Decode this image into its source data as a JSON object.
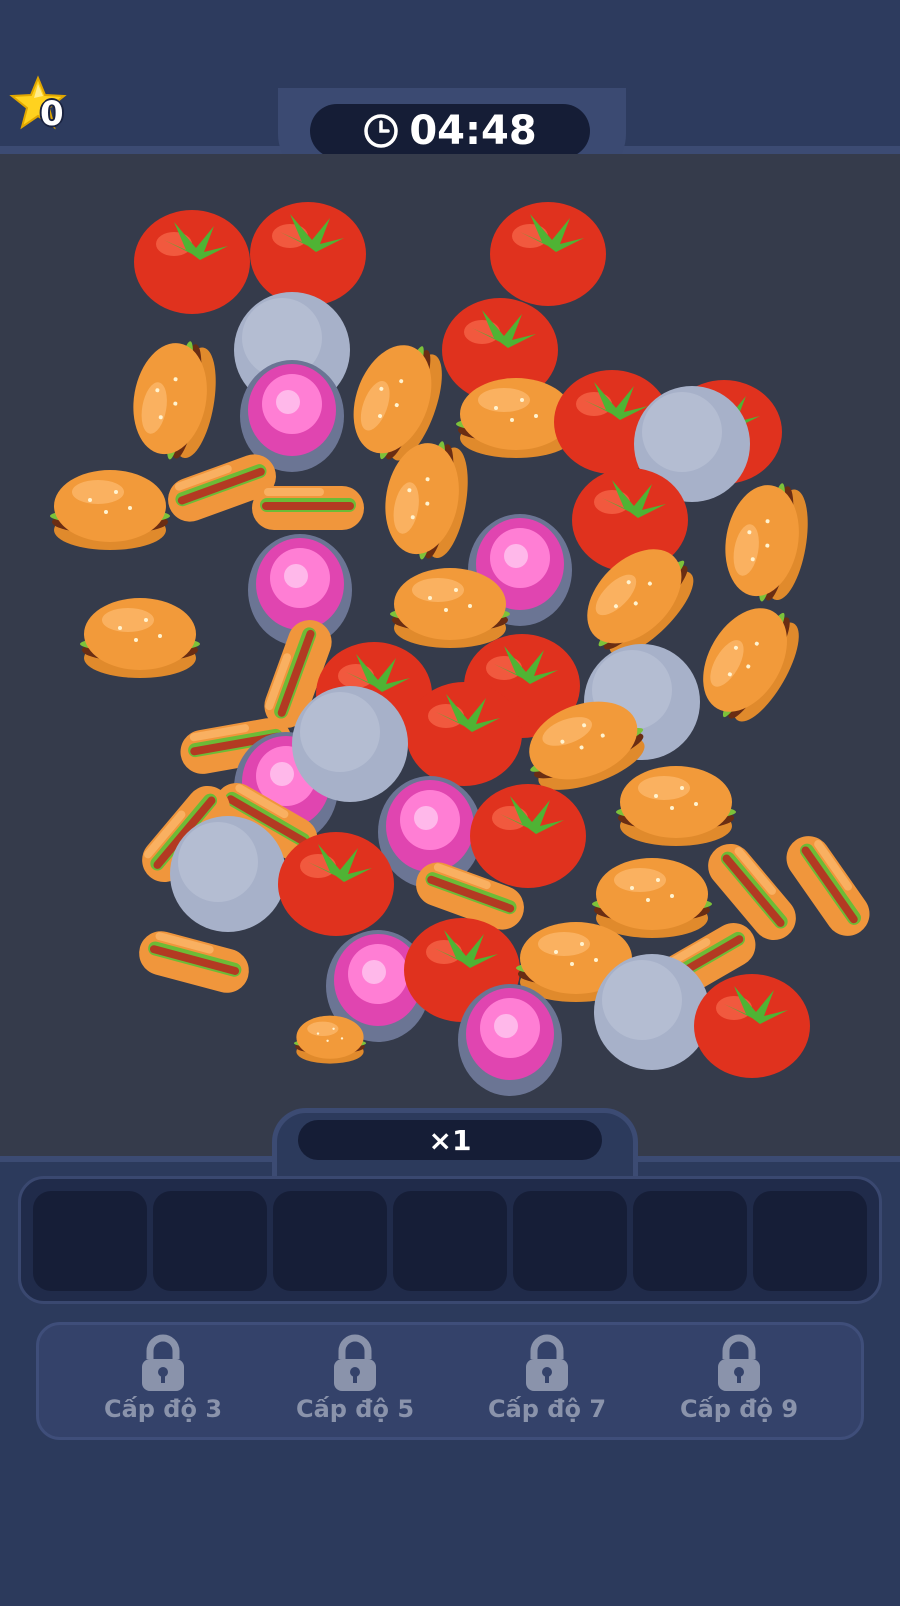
{
  "score": {
    "value": "0",
    "icon": "star-icon"
  },
  "timer": {
    "value": "04:48",
    "icon": "clock-icon"
  },
  "combo": {
    "label": "×1"
  },
  "slots": {
    "count": 7
  },
  "locked_boosters": [
    {
      "label": "Cấp độ 3",
      "icon": "lock-icon"
    },
    {
      "label": "Cấp độ 5",
      "icon": "lock-icon"
    },
    {
      "label": "Cấp độ 7",
      "icon": "lock-icon"
    },
    {
      "label": "Cấp độ 9",
      "icon": "lock-icon"
    }
  ],
  "pile_items": [
    "hamburger",
    "hot-dog",
    "tomato",
    "pink-jar",
    "gray-lid"
  ],
  "colors": {
    "background": "#2c3a5c",
    "board": "#353b4b",
    "slot": "#161e37",
    "accent_star": "#ffd21f"
  }
}
